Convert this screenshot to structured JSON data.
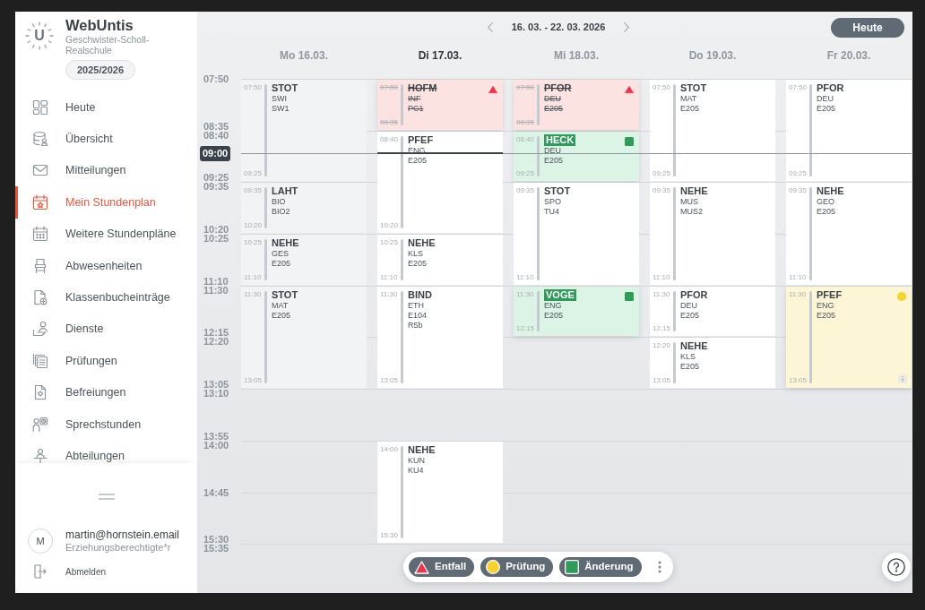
{
  "sidebar": {
    "logo_letter": "U",
    "app_name": "WebUntis",
    "school": "Geschwister-Scholl-Realschule",
    "school_year": "2025/2026",
    "items": [
      {
        "label": "Heute",
        "selected": false
      },
      {
        "label": "Übersicht",
        "selected": false
      },
      {
        "label": "Mitteilungen",
        "selected": false
      },
      {
        "label": "Mein Stundenplan",
        "selected": true
      },
      {
        "label": "Weitere Stundenpläne",
        "selected": false
      },
      {
        "label": "Abwesenheiten",
        "selected": false
      },
      {
        "label": "Klassenbucheinträge",
        "selected": false
      },
      {
        "label": "Dienste",
        "selected": false
      },
      {
        "label": "Prüfungen",
        "selected": false
      },
      {
        "label": "Befreiungen",
        "selected": false
      },
      {
        "label": "Sprechstunden",
        "selected": false
      },
      {
        "label": "Abteilungen",
        "selected": false
      }
    ],
    "user": {
      "avatar_letter": "M",
      "email": "martin@hornstein.email",
      "role": "Erziehungsberechtigte*r"
    },
    "logout": "Abmelden"
  },
  "calendar": {
    "date_range": "16. 03. - 22. 03. 2026",
    "today_button": "Heute",
    "time_labels": [
      [
        "07:50"
      ],
      [
        "08:35",
        "08:40"
      ],
      [
        "09:25",
        "09:35"
      ],
      [
        "10:20",
        "10:25"
      ],
      [
        "11:10",
        "11:30"
      ],
      [
        "12:15",
        "12:20"
      ],
      [
        "13:05",
        "13:10"
      ],
      [
        "13:55",
        "14:00"
      ],
      [
        "14:45"
      ],
      [
        "15:30",
        "15:35"
      ]
    ],
    "now": "09:00",
    "days": [
      {
        "label": "Mo 16.03.",
        "today": false,
        "past": true,
        "lessons": [
          {
            "start": "07:50",
            "end": "09:25",
            "teacher": "STOT",
            "details": [
              "SWI",
              "SW1"
            ],
            "kind": "normal"
          },
          {
            "start": "09:35",
            "end": "10:20",
            "teacher": "LAHT",
            "details": [
              "BIO",
              "BIO2"
            ],
            "kind": "normal"
          },
          {
            "start": "10:25",
            "end": "11:10",
            "teacher": "NEHE",
            "details": [
              "GES",
              "E205"
            ],
            "kind": "normal"
          },
          {
            "start": "11:30",
            "end": "13:05",
            "teacher": "STOT",
            "details": [
              "MAT",
              "E205"
            ],
            "kind": "normal"
          }
        ]
      },
      {
        "label": "Di 17.03.",
        "today": true,
        "past": false,
        "lessons": [
          {
            "start": "07:50",
            "end": "08:35",
            "teacher": "HOFM",
            "details": [
              "INF",
              "PC1"
            ],
            "kind": "cancelled"
          },
          {
            "start": "08:40",
            "end": "10:20",
            "teacher": "PFEF",
            "details": [
              "ENG",
              "E205"
            ],
            "kind": "normal"
          },
          {
            "start": "10:25",
            "end": "11:10",
            "teacher": "NEHE",
            "details": [
              "KLS",
              "E205"
            ],
            "kind": "normal"
          },
          {
            "start": "11:30",
            "end": "13:05",
            "teacher": "BIND",
            "details": [
              "ETH",
              "E104",
              "R5b"
            ],
            "kind": "normal"
          },
          {
            "start": "14:00",
            "end": "15:30",
            "teacher": "NEHE",
            "details": [
              "KUN",
              "KU4"
            ],
            "kind": "normal"
          }
        ]
      },
      {
        "label": "Mi 18.03.",
        "today": false,
        "past": false,
        "lessons": [
          {
            "start": "07:50",
            "end": "08:35",
            "teacher": "PFOR",
            "details": [
              "DEU",
              "E205"
            ],
            "kind": "cancelled"
          },
          {
            "start": "08:40",
            "end": "09:25",
            "teacher": "HECK",
            "details": [
              "DEU",
              "E205"
            ],
            "kind": "changed"
          },
          {
            "start": "09:35",
            "end": "11:10",
            "teacher": "STOT",
            "details": [
              "SPO",
              "TU4"
            ],
            "kind": "normal"
          },
          {
            "start": "11:30",
            "end": "12:15",
            "teacher": "VOGE",
            "details": [
              "ENG",
              "E205"
            ],
            "kind": "changed"
          }
        ]
      },
      {
        "label": "Do 19.03.",
        "today": false,
        "past": false,
        "lessons": [
          {
            "start": "07:50",
            "end": "09:25",
            "teacher": "STOT",
            "details": [
              "MAT",
              "E205"
            ],
            "kind": "normal"
          },
          {
            "start": "09:35",
            "end": "11:10",
            "teacher": "NEHE",
            "details": [
              "MUS",
              "MUS2"
            ],
            "kind": "normal"
          },
          {
            "start": "11:30",
            "end": "12:15",
            "teacher": "PFOR",
            "details": [
              "DEU",
              "E205"
            ],
            "kind": "normal"
          },
          {
            "start": "12:20",
            "end": "13:05",
            "teacher": "NEHE",
            "details": [
              "KLS",
              "E205"
            ],
            "kind": "normal"
          }
        ]
      },
      {
        "label": "Fr 20.03.",
        "today": false,
        "past": false,
        "lessons": [
          {
            "start": "07:50",
            "end": "09:25",
            "teacher": "PFOR",
            "details": [
              "DEU",
              "E205"
            ],
            "kind": "normal"
          },
          {
            "start": "09:35",
            "end": "11:10",
            "teacher": "NEHE",
            "details": [
              "GEO",
              "E205"
            ],
            "kind": "normal"
          },
          {
            "start": "11:30",
            "end": "13:05",
            "teacher": "PFEF",
            "details": [
              "ENG",
              "E205"
            ],
            "kind": "exam"
          }
        ]
      }
    ],
    "legend": [
      {
        "label": "Entfall",
        "kind": "cancelled"
      },
      {
        "label": "Prüfung",
        "kind": "exam"
      },
      {
        "label": "Änderung",
        "kind": "changed"
      }
    ]
  }
}
